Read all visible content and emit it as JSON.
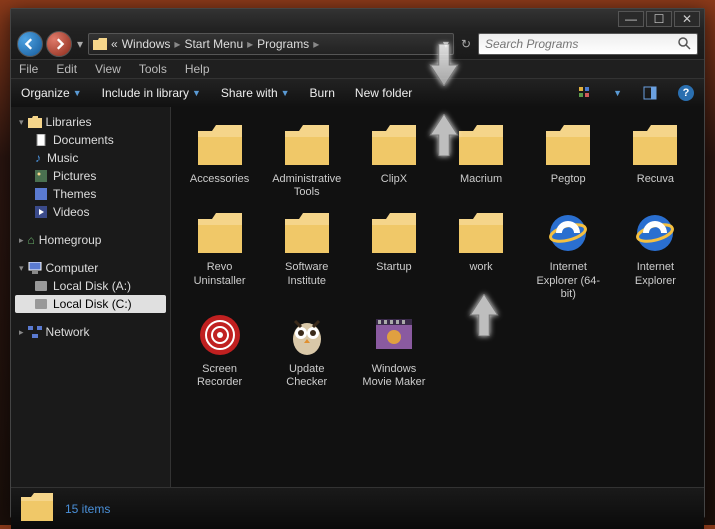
{
  "window_controls": {
    "min": "—",
    "max": "☐",
    "close": "✕"
  },
  "breadcrumb": {
    "pre": "«",
    "parts": [
      "Windows",
      "Start Menu",
      "Programs"
    ]
  },
  "search": {
    "placeholder": "Search Programs"
  },
  "menubar": [
    "File",
    "Edit",
    "View",
    "Tools",
    "Help"
  ],
  "toolbar": {
    "organize": "Organize",
    "include": "Include in library",
    "share": "Share with",
    "burn": "Burn",
    "newfolder": "New folder"
  },
  "sidebar": {
    "libraries": {
      "label": "Libraries",
      "items": [
        {
          "label": "Documents",
          "icon": "documents"
        },
        {
          "label": "Music",
          "icon": "music"
        },
        {
          "label": "Pictures",
          "icon": "pictures"
        },
        {
          "label": "Themes",
          "icon": "themes"
        },
        {
          "label": "Videos",
          "icon": "videos"
        }
      ]
    },
    "homegroup": {
      "label": "Homegroup"
    },
    "computer": {
      "label": "Computer",
      "items": [
        {
          "label": "Local Disk (A:)",
          "icon": "disk",
          "sel": false
        },
        {
          "label": "Local Disk (C:)",
          "icon": "disk",
          "sel": true
        }
      ]
    },
    "network": {
      "label": "Network"
    }
  },
  "items": [
    {
      "label": "Accessories",
      "type": "folder"
    },
    {
      "label": "Administrative Tools",
      "type": "folder"
    },
    {
      "label": "ClipX",
      "type": "folder"
    },
    {
      "label": "Macrium",
      "type": "folder"
    },
    {
      "label": "Pegtop",
      "type": "folder"
    },
    {
      "label": "Recuva",
      "type": "folder"
    },
    {
      "label": "Revo Uninstaller",
      "type": "folder"
    },
    {
      "label": "Software Institute",
      "type": "folder"
    },
    {
      "label": "Startup",
      "type": "folder"
    },
    {
      "label": "work",
      "type": "folder"
    },
    {
      "label": "Internet Explorer (64-bit)",
      "type": "ie"
    },
    {
      "label": "Internet Explorer",
      "type": "ie"
    },
    {
      "label": "Screen Recorder",
      "type": "recorder"
    },
    {
      "label": "Update Checker",
      "type": "owl"
    },
    {
      "label": "Windows Movie Maker",
      "type": "movie"
    }
  ],
  "status": {
    "count": "15 items"
  }
}
